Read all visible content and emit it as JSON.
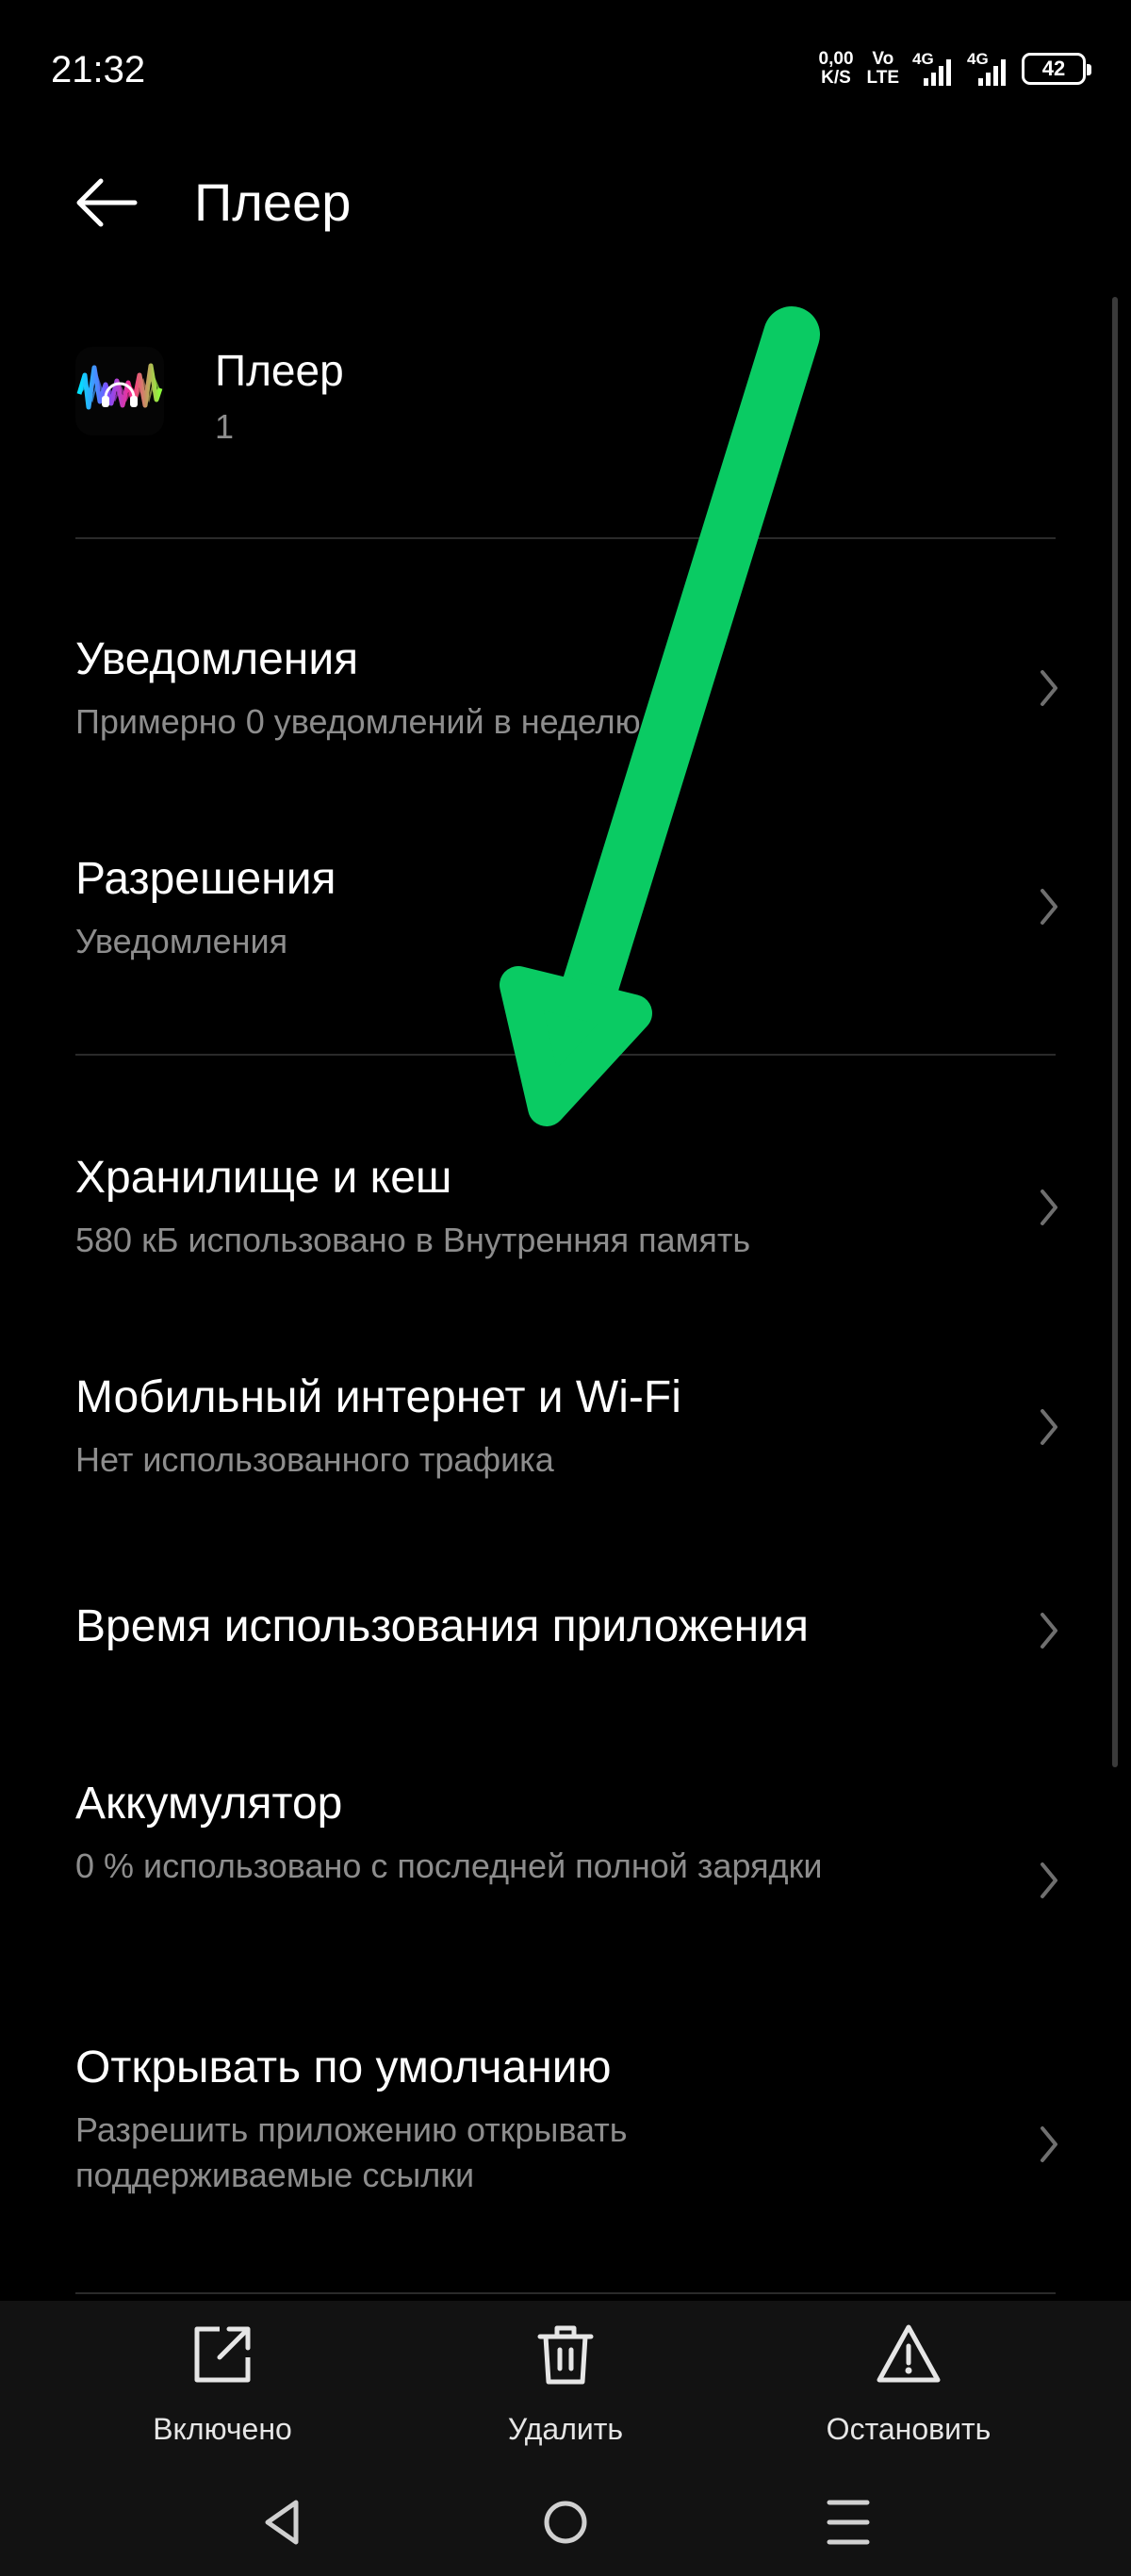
{
  "status_bar": {
    "time": "21:32",
    "net_speed_value": "0,00",
    "net_speed_unit": "K/S",
    "volte_top": "Vo",
    "volte_bottom": "LTE",
    "signal1_tag": "4G",
    "signal2_tag": "4G",
    "battery": "42"
  },
  "header": {
    "title": "Плеер",
    "back_icon": "arrow-left-icon"
  },
  "app": {
    "name": "Плеер",
    "version": "1",
    "icon": "waveform-headphones-icon"
  },
  "list": [
    {
      "title": "Уведомления",
      "subtitle": "Примерно 0 уведомлений в неделю"
    },
    {
      "title": "Разрешения",
      "subtitle": "Уведомления"
    },
    {
      "title": "Хранилище и кеш",
      "subtitle": "580 кБ использовано в Внутренняя память"
    },
    {
      "title": "Мобильный интернет и Wi-Fi",
      "subtitle": "Нет использованного трафика"
    },
    {
      "title": "Время использования приложения"
    },
    {
      "title": "Аккумулятор",
      "subtitle": "0 % использовано с последней полной зарядки"
    },
    {
      "title": "Открывать по умолчанию",
      "subtitle": "Разрешить приложению открывать поддерживаемые ссылки"
    }
  ],
  "actions": [
    {
      "label": "Включено",
      "icon": "open-external-icon"
    },
    {
      "label": "Удалить",
      "icon": "trash-icon"
    },
    {
      "label": "Остановить",
      "icon": "warning-icon"
    }
  ],
  "colors": {
    "background": "#000000",
    "secondary_text": "#8d8d8d",
    "annotation_arrow": "#0acb63",
    "bottom_bar": "#121212"
  }
}
